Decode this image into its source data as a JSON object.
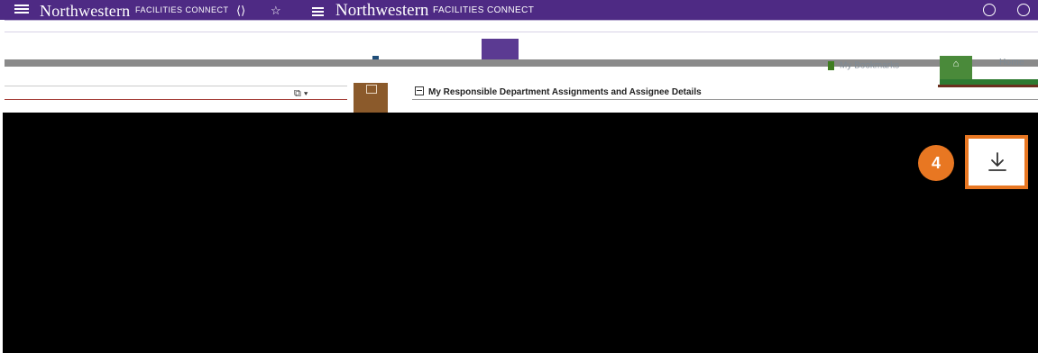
{
  "header": {
    "brand": "Northwestern",
    "brand_subtitle": "FACILITIES CONNECT",
    "brand2": "Northwestern",
    "brand2_subtitle": "FACILITIES CONNECT"
  },
  "nav": {
    "bookmarks_label": "My Bookmarks",
    "home_label": "Home"
  },
  "panel": {
    "section_title": "My Responsible Department Assignments and Assignee Details"
  },
  "callout": {
    "step_number": "4"
  },
  "colors": {
    "brand_purple": "#4e2a84",
    "accent_orange": "#e87722"
  },
  "icons": {
    "menu": "menu-icon",
    "help": "help-icon",
    "user": "user-icon",
    "home": "home-icon",
    "download": "download-icon"
  }
}
